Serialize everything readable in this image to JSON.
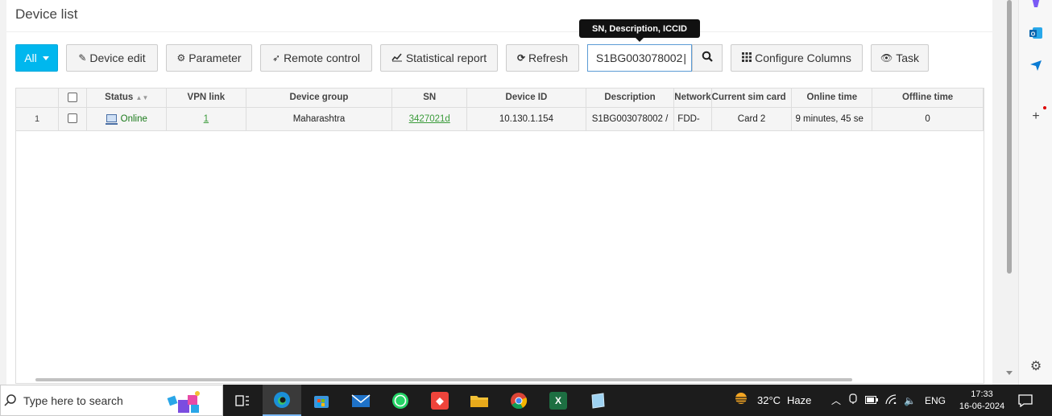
{
  "page": {
    "title": "Device list"
  },
  "toolbar": {
    "all_label": "All",
    "device_edit": "Device edit",
    "parameter": "Parameter",
    "remote_control": "Remote control",
    "statistical_report": "Statistical report",
    "refresh": "Refresh",
    "search_value": "S1BG003078002",
    "configure_columns": "Configure Columns",
    "task": "Task"
  },
  "tooltip": {
    "text": "SN, Description, ICCID"
  },
  "table": {
    "columns": [
      "",
      "",
      "Status",
      "VPN link",
      "Device group",
      "SN",
      "Device ID",
      "Description",
      "Network",
      "Current sim card",
      "Online time",
      "Offline time"
    ],
    "rows": [
      {
        "index": "1",
        "status": "Online",
        "vpn_link": "1",
        "device_group": "Maharashtra",
        "sn": "3427021d",
        "device_id": "10.130.1.154",
        "description": "S1BG003078002 /",
        "network": "FDD-",
        "current_sim": "Card 2",
        "online_time": "9 minutes, 45 se",
        "offline_time": "0"
      }
    ]
  },
  "taskbar": {
    "search_placeholder": "Type here to search",
    "weather_temp": "32°C",
    "weather_desc": "Haze",
    "language": "ENG",
    "time": "17:33",
    "date": "16-06-2024"
  },
  "colors": {
    "accent": "#00b7ee",
    "online": "#1a7a1a",
    "link": "#3a9b3a"
  }
}
